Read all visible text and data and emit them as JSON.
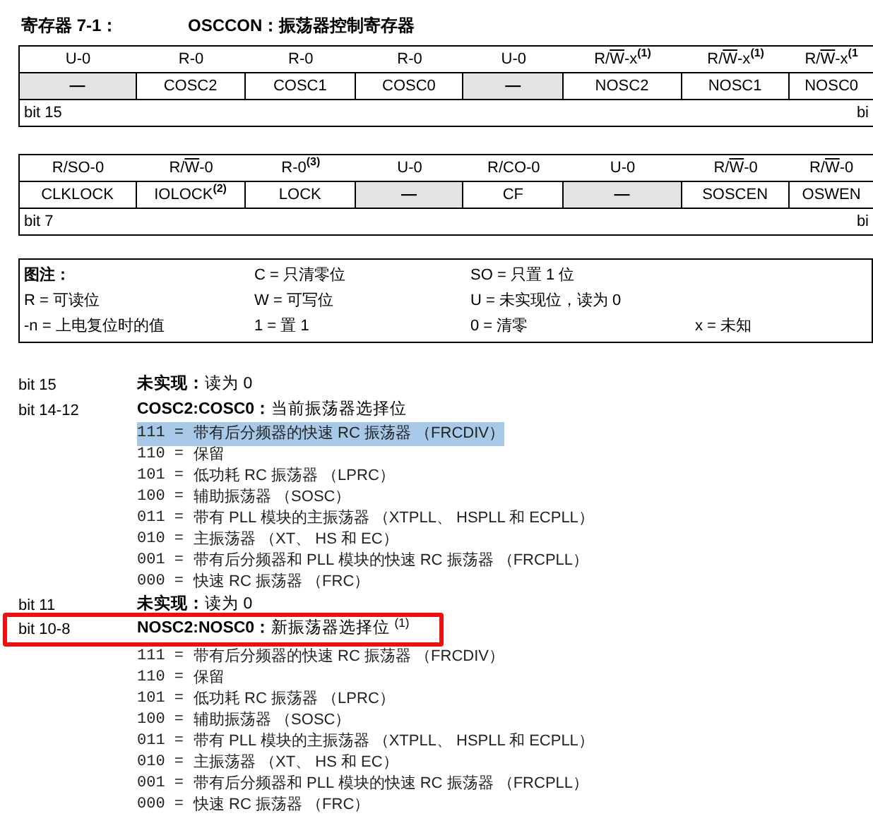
{
  "title": {
    "label": "寄存器 7-1：",
    "name": "OSCCON：振荡器控制寄存器"
  },
  "registers": [
    {
      "cells": [
        {
          "pre": "U-0",
          "name": "—",
          "implemented": false
        },
        {
          "pre": "R-0",
          "name": "COSC2",
          "implemented": true
        },
        {
          "pre": "R-0",
          "name": "COSC1",
          "implemented": true
        },
        {
          "pre": "R-0",
          "name": "COSC0",
          "implemented": true
        },
        {
          "pre": "U-0",
          "name": "—",
          "implemented": false
        },
        {
          "pre": "R/",
          "bar": "W",
          "post": "-x",
          "note": "(1)",
          "name": "NOSC2",
          "implemented": true
        },
        {
          "pre": "R/",
          "bar": "W",
          "post": "-x",
          "note": "(1)",
          "name": "NOSC1",
          "implemented": true
        },
        {
          "pre": "R/",
          "bar": "W",
          "post": "-x",
          "note": "(1",
          "name": "NOSC0",
          "implemented": true
        }
      ],
      "high_bit": "bit 15",
      "low_bit": "bi"
    },
    {
      "cells": [
        {
          "pre": "R/SO-0",
          "name": "CLKLOCK",
          "implemented": true
        },
        {
          "pre": "R/",
          "bar": "W",
          "post": "-0",
          "name": "IOLOCK",
          "name_note": "(2)",
          "implemented": true
        },
        {
          "pre": "R-0",
          "note": "(3)",
          "name": "LOCK",
          "implemented": true
        },
        {
          "pre": "U-0",
          "name": "—",
          "implemented": false
        },
        {
          "pre": "R/CO-0",
          "name": "CF",
          "implemented": true
        },
        {
          "pre": "U-0",
          "name": "—",
          "implemented": false
        },
        {
          "pre": "R/",
          "bar": "W",
          "post": "-0",
          "name": "SOSCEN",
          "implemented": true
        },
        {
          "pre": "R/",
          "bar": "W",
          "post": "-0",
          "name": "OSWEN",
          "implemented": true
        }
      ],
      "high_bit": "bit 7",
      "low_bit": "bi"
    }
  ],
  "legend": {
    "heading": "图注：",
    "rows": [
      [
        "",
        "C = 只清零位",
        "SO = 只置 1 位",
        ""
      ],
      [
        "R = 可读位",
        "W = 可写位",
        "U = 未实现位，读为 0",
        ""
      ],
      [
        "-n = 上电复位时的值",
        "1 = 置 1",
        "0 = 清零",
        "x = 未知"
      ]
    ]
  },
  "bits": [
    {
      "bit": "bit 15",
      "text": "**未实现：**读为 0",
      "boxed": false
    },
    {
      "bit": "bit 14-12",
      "text": "**COSC2:COSC0：**当前振荡器选择位",
      "boxed": false,
      "options": [
        {
          "code": "111 =",
          "text": "带有后分频器的快速 RC 振荡器 （FRCDIV）",
          "selected": true
        },
        {
          "code": "110 =",
          "text": "保留",
          "selected": false
        },
        {
          "code": "101 =",
          "text": "低功耗 RC 振荡器 （LPRC）",
          "selected": false
        },
        {
          "code": "100 =",
          "text": "辅助振荡器 （SOSC）",
          "selected": false
        },
        {
          "code": "011 =",
          "text": "带有 PLL 模块的主振荡器 （XTPLL、 HSPLL 和 ECPLL）",
          "selected": false
        },
        {
          "code": "010 =",
          "text": "主振荡器 （XT、 HS 和 EC）",
          "selected": false
        },
        {
          "code": "001 =",
          "text": "带有后分频器和 PLL 模块的快速 RC 振荡器 （FRCPLL）",
          "selected": false
        },
        {
          "code": "000 =",
          "text": "快速 RC 振荡器 （FRC）",
          "selected": false
        }
      ]
    },
    {
      "bit": "bit 11",
      "text": "**未实现：**读为 0",
      "boxed": false
    },
    {
      "bit": "bit 10-8",
      "text": "**NOSC2:NOSC0：**新振荡器选择位 $^{(1)}$",
      "boxed": true,
      "options": [
        {
          "code": "111 =",
          "text": "带有后分频器的快速 RC 振荡器 （FRCDIV）",
          "selected": false
        },
        {
          "code": "110 =",
          "text": "保留",
          "selected": false
        },
        {
          "code": "101 =",
          "text": "低功耗 RC 振荡器 （LPRC）",
          "selected": false
        },
        {
          "code": "100 =",
          "text": "辅助振荡器 （SOSC）",
          "selected": false
        },
        {
          "code": "011 =",
          "text": "带有 PLL 模块的主振荡器 （XTPLL、 HSPLL 和 ECPLL）",
          "selected": false
        },
        {
          "code": "010 =",
          "text": "主振荡器 （XT、 HS 和 EC）",
          "selected": false
        },
        {
          "code": "001 =",
          "text": "带有后分频器和 PLL 模块的快速 RC 振荡器 （FRCPLL）",
          "selected": false
        },
        {
          "code": "000 =",
          "text": "快速 RC 振荡器 （FRC）",
          "selected": false
        }
      ]
    }
  ]
}
